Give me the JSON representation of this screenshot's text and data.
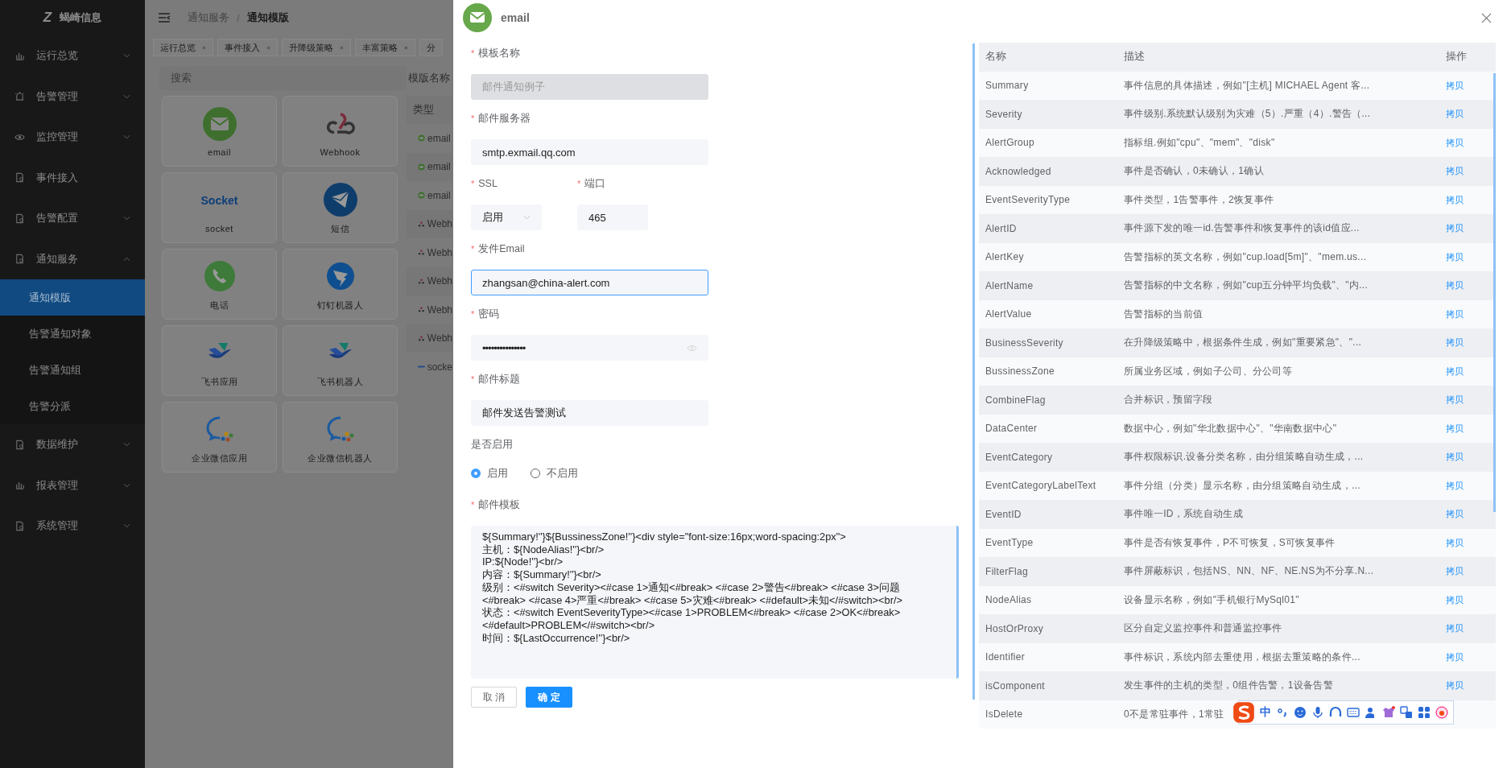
{
  "brand": {
    "name": "蝎崎信息",
    "logo_text": "Z"
  },
  "sidebar": {
    "items": [
      {
        "label": "运行总览",
        "kind": "group",
        "expanded": false
      },
      {
        "label": "告警管理",
        "kind": "group",
        "expanded": false
      },
      {
        "label": "监控管理",
        "kind": "group",
        "expanded": false
      },
      {
        "label": "事件接入",
        "kind": "link"
      },
      {
        "label": "告警配置",
        "kind": "group",
        "expanded": false
      },
      {
        "label": "通知服务",
        "kind": "group",
        "expanded": true,
        "children": [
          {
            "label": "通知模版",
            "selected": true
          },
          {
            "label": "告警通知对象",
            "selected": false
          },
          {
            "label": "告警通知组",
            "selected": false
          },
          {
            "label": "告警分派",
            "selected": false
          }
        ]
      },
      {
        "label": "数据维护",
        "kind": "group",
        "expanded": false
      },
      {
        "label": "报表管理",
        "kind": "group",
        "expanded": false
      },
      {
        "label": "系统管理",
        "kind": "group",
        "expanded": false
      }
    ]
  },
  "breadcrumb": {
    "separator": "/",
    "items": [
      "通知服务",
      "通知模版"
    ]
  },
  "tabs": [
    {
      "label": "运行总览",
      "selected": false,
      "closable": true
    },
    {
      "label": "事件接入",
      "selected": false,
      "closable": true
    },
    {
      "label": "升降级策略",
      "selected": false,
      "closable": true
    },
    {
      "label": "丰富策略",
      "selected": false,
      "closable": true
    },
    {
      "label": "分",
      "selected": false,
      "closable": false
    }
  ],
  "search": {
    "placeholder": "搜索"
  },
  "channels": [
    {
      "label": "email",
      "kind": "email"
    },
    {
      "label": "Webhook",
      "kind": "webhook"
    },
    {
      "label": "socket",
      "kind": "socket",
      "logo_text": "Socket"
    },
    {
      "label": "短信",
      "kind": "sms"
    },
    {
      "label": "电话",
      "kind": "phone"
    },
    {
      "label": "钉钉机器人",
      "kind": "dingtalk"
    },
    {
      "label": "飞书应用",
      "kind": "feishu"
    },
    {
      "label": "飞书机器人",
      "kind": "feishu"
    },
    {
      "label": "企业微信应用",
      "kind": "wecom"
    },
    {
      "label": "企业微信机器人",
      "kind": "wecom"
    }
  ],
  "template_list": {
    "filter_label": "模版名称",
    "header": "类型",
    "rows": [
      {
        "type": "email",
        "kind": "email"
      },
      {
        "type": "email",
        "kind": "email"
      },
      {
        "type": "email",
        "kind": "email"
      },
      {
        "type": "Webh",
        "kind": "webhook"
      },
      {
        "type": "Webh",
        "kind": "webhook"
      },
      {
        "type": "Webh",
        "kind": "webhook"
      },
      {
        "type": "Webh",
        "kind": "webhook"
      },
      {
        "type": "Webh",
        "kind": "webhook"
      },
      {
        "type": "socke",
        "kind": "socket"
      }
    ]
  },
  "dialog": {
    "title": "email",
    "required_mark": "*",
    "fields": [
      {
        "kind": "text",
        "label": "模板名称",
        "required": true,
        "value": "邮件通知例子",
        "disabled": true,
        "focused": false
      },
      {
        "kind": "text",
        "label": "邮件服务器",
        "required": true,
        "value": "smtp.exmail.qq.com",
        "disabled": false,
        "focused": false
      },
      {
        "kind": "pair",
        "fields": [
          {
            "kind": "select",
            "label": "SSL",
            "required": true,
            "value": "启用"
          },
          {
            "kind": "text",
            "label": "端口",
            "required": true,
            "value": "465",
            "disabled": false,
            "focused": false
          }
        ]
      },
      {
        "kind": "text",
        "label": "发件Email",
        "required": true,
        "value": "zhangsan@china-alert.com",
        "disabled": false,
        "focused": true
      },
      {
        "kind": "password",
        "label": "密码",
        "required": true,
        "value": "•••••••••••••••"
      },
      {
        "kind": "text",
        "label": "邮件标题",
        "required": true,
        "value": "邮件发送告警测试",
        "disabled": false,
        "focused": false
      },
      {
        "kind": "radio",
        "label": "是否启用",
        "required": false,
        "options": [
          {
            "label": "启用",
            "selected": true
          },
          {
            "label": "不启用",
            "selected": false
          }
        ]
      },
      {
        "kind": "textarea",
        "label": "邮件模板",
        "required": true,
        "value": "${Summary!''}${BussinessZone!''}<div style=\"font-size:16px;word-spacing:2px\">\n主机：${NodeAlias!''}<br/>\nIP:${Node!''}<br/>\n内容：${Summary!''}<br/>\n级别：<#switch Severity><#case 1>通知<#break> <#case 2>警告<#break> <#case 3>问题<#break> <#case 4>严重<#break> <#case 5>灾难<#break> <#default>未知</#switch><br/>\n状态：<#switch EventSeverityType><#case 1>PROBLEM<#break> <#case 2>OK<#break> <#default>PROBLEM</#switch><br/>\n时间：${LastOccurrence!''}<br/>"
      }
    ],
    "buttons": [
      {
        "label": "取 消",
        "kind": "default"
      },
      {
        "label": "确 定",
        "kind": "primary"
      }
    ],
    "variables": {
      "columns": [
        "名称",
        "描述",
        "操作"
      ],
      "rows": [
        {
          "name": "Summary",
          "description": "事件信息的具体描述，例如\"[主机] MICHAEL Agent 客...",
          "action": "拷贝"
        },
        {
          "name": "Severity",
          "description": "事件级别.系统默认级别为灾难（5）.严重（4）.警告（...",
          "action": "拷贝"
        },
        {
          "name": "AlertGroup",
          "description": "指标组.例如\"cpu\"、\"mem\"、\"disk\"",
          "action": "拷贝"
        },
        {
          "name": "Acknowledged",
          "description": "事件是否确认，0未确认，1确认",
          "action": "拷贝"
        },
        {
          "name": "EventSeverityType",
          "description": "事件类型，1告警事件，2恢复事件",
          "action": "拷贝"
        },
        {
          "name": "AlertID",
          "description": "事件源下发的唯一id.告警事件和恢复事件的该id值应...",
          "action": "拷贝"
        },
        {
          "name": "AlertKey",
          "description": "告警指标的英文名称，例如\"cup.load[5m]\"、\"mem.us...",
          "action": "拷贝"
        },
        {
          "name": "AlertName",
          "description": "告警指标的中文名称，例如\"cup五分钟平均负载\"、\"内...",
          "action": "拷贝"
        },
        {
          "name": "AlertValue",
          "description": "告警指标的当前值",
          "action": "拷贝"
        },
        {
          "name": "BusinessSeverity",
          "description": "在升降级策略中，根据条件生成，例如\"重要紧急\"、\"...",
          "action": "拷贝"
        },
        {
          "name": "BussinessZone",
          "description": "所属业务区域，例如子公司、分公司等",
          "action": "拷贝"
        },
        {
          "name": "CombineFlag",
          "description": "合并标识，预留字段",
          "action": "拷贝"
        },
        {
          "name": "DataCenter",
          "description": "数据中心，例如\"华北数据中心\"、\"华南数据中心\"",
          "action": "拷贝"
        },
        {
          "name": "EventCategory",
          "description": "事件权限标识.设备分类名称，由分组策略自动生成，...",
          "action": "拷贝"
        },
        {
          "name": "EventCategoryLabelText",
          "description": "事件分组（分类）显示名称，由分组策略自动生成，...",
          "action": "拷贝"
        },
        {
          "name": "EventID",
          "description": "事件唯一ID，系统自动生成",
          "action": "拷贝"
        },
        {
          "name": "EventType",
          "description": "事件是否有恢复事件，P不可恢复，S可恢复事件",
          "action": "拷贝"
        },
        {
          "name": "FilterFlag",
          "description": "事件屏蔽标识，包括NS、NN、NF、NE.NS为不分享.N...",
          "action": "拷贝"
        },
        {
          "name": "NodeAlias",
          "description": "设备显示名称，例如\"手机银行MySql01\"",
          "action": "拷贝"
        },
        {
          "name": "HostOrProxy",
          "description": "区分自定义监控事件和普通监控事件",
          "action": "拷贝"
        },
        {
          "name": "Identifier",
          "description": "事件标识，系统内部去重使用，根据去重策略的条件...",
          "action": "拷贝"
        },
        {
          "name": "isComponent",
          "description": "发生事件的主机的类型，0组件告警，1设备告警",
          "action": "拷贝"
        },
        {
          "name": "IsDelete",
          "description": "0不是常驻事件，1常驻"
        }
      ]
    }
  },
  "ime_toolbar": {
    "mode": "中"
  }
}
